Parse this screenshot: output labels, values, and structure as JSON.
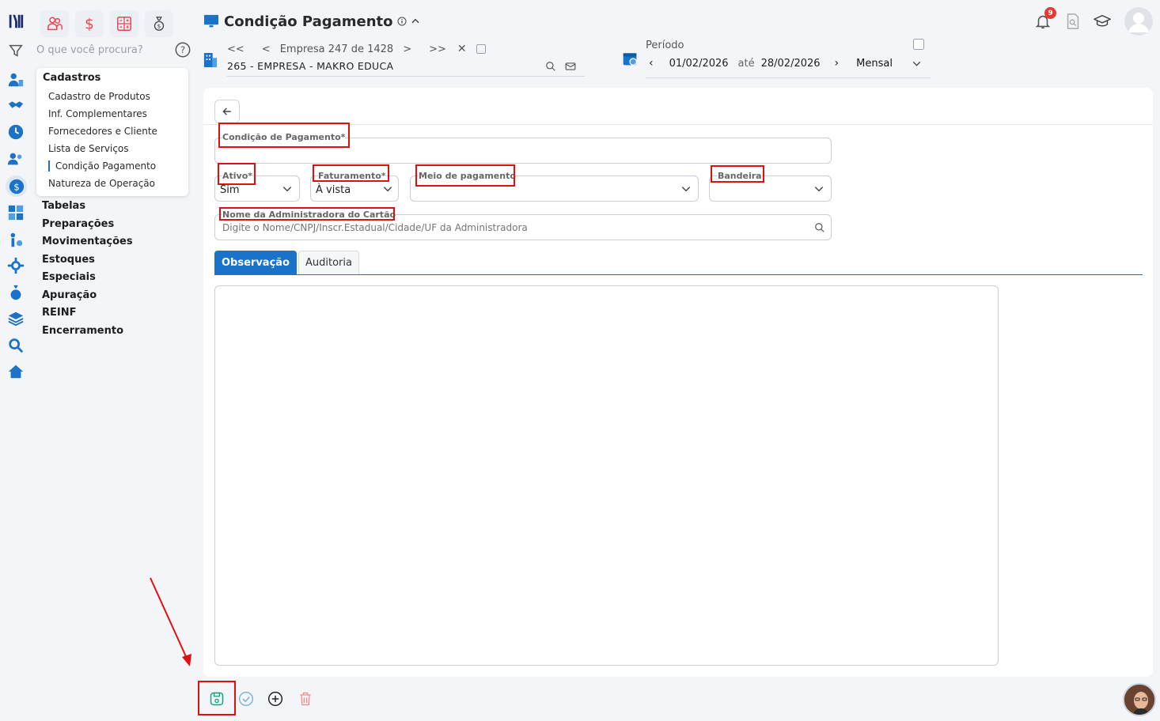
{
  "sidebar": {
    "search_placeholder": "O que você procura?",
    "menu": {
      "title": "Cadastros",
      "items": [
        {
          "label": "Cadastro de Produtos"
        },
        {
          "label": "Inf. Complementares"
        },
        {
          "label": "Fornecedores e Cliente"
        },
        {
          "label": "Lista de Serviços"
        },
        {
          "label": "Condição Pagamento",
          "active": true
        },
        {
          "label": "Natureza de Operação"
        }
      ]
    },
    "groups": [
      {
        "label": "Tabelas"
      },
      {
        "label": "Preparações"
      },
      {
        "label": "Movimentações"
      },
      {
        "label": "Estoques"
      },
      {
        "label": "Especiais"
      },
      {
        "label": "Apuração"
      },
      {
        "label": "REINF"
      },
      {
        "label": "Encerramento"
      }
    ]
  },
  "header": {
    "title": "Condição Pagamento",
    "company": {
      "nav_text": "Empresa 247 de 1428",
      "name": "265 - EMPRESA - MAKRO EDUCA"
    },
    "period": {
      "label": "Período",
      "start": "01/02/2026",
      "connector": "até",
      "end": "28/02/2026",
      "mode": "Mensal"
    },
    "notifications_count": "9"
  },
  "form": {
    "condicao_label": "Condição de Pagamento*",
    "ativo": {
      "label": "Ativo*",
      "value": "Sim"
    },
    "faturamento": {
      "label": "Faturamento*",
      "value": "À vista"
    },
    "meio": {
      "label": "Meio de pagamento",
      "value": ""
    },
    "bandeira": {
      "label": "Bandeira",
      "value": ""
    },
    "administradora": {
      "label": "Nome da Administradora do Cartão",
      "placeholder": "Digite o Nome/CNPJ/Inscr.Estadual/Cidade/UF da Administradora"
    },
    "tabs": [
      {
        "label": "Observação",
        "active": true
      },
      {
        "label": "Auditoria"
      }
    ]
  },
  "colors": {
    "accent": "#1a73c8",
    "highlight": "#e01010",
    "module_icon": "#e8464f",
    "save_icon": "#1aa37a"
  }
}
